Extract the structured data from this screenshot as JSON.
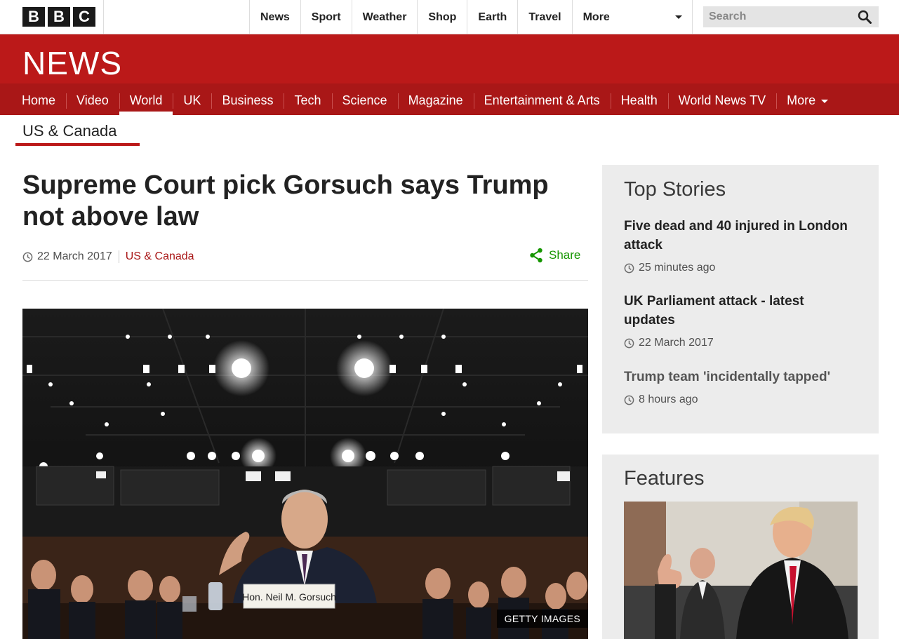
{
  "masthead": {
    "logo_letters": [
      "B",
      "B",
      "C"
    ],
    "top_nav": [
      "News",
      "Sport",
      "Weather",
      "Shop",
      "Earth",
      "Travel"
    ],
    "more_label": "More",
    "search_placeholder": "Search"
  },
  "news_band": {
    "wordmark": "NEWS",
    "nav": [
      "Home",
      "Video",
      "World",
      "UK",
      "Business",
      "Tech",
      "Science",
      "Magazine",
      "Entertainment & Arts",
      "Health",
      "World News TV"
    ],
    "active": "World",
    "more_label": "More"
  },
  "subsection": {
    "label": "US & Canada"
  },
  "article": {
    "headline": "Supreme Court pick Gorsuch says Trump not above law",
    "date": "22 March 2017",
    "section": "US & Canada",
    "share_label": "Share",
    "image": {
      "nameplate": "Hon. Neil M. Gorsuch",
      "credit": "GETTY IMAGES"
    }
  },
  "top_stories": {
    "title": "Top Stories",
    "items": [
      {
        "title": "Five dead and 40 injured in London attack",
        "time": "25 minutes ago"
      },
      {
        "title": "UK Parliament attack - latest updates",
        "time": "22 March 2017"
      },
      {
        "title": "Trump team 'incidentally tapped'",
        "time": "8 hours ago"
      }
    ]
  },
  "features": {
    "title": "Features"
  },
  "colors": {
    "brand_red": "#bb1919",
    "nav_red": "#a91717",
    "share_green": "#169600",
    "sidebar_bg": "#ececec"
  }
}
